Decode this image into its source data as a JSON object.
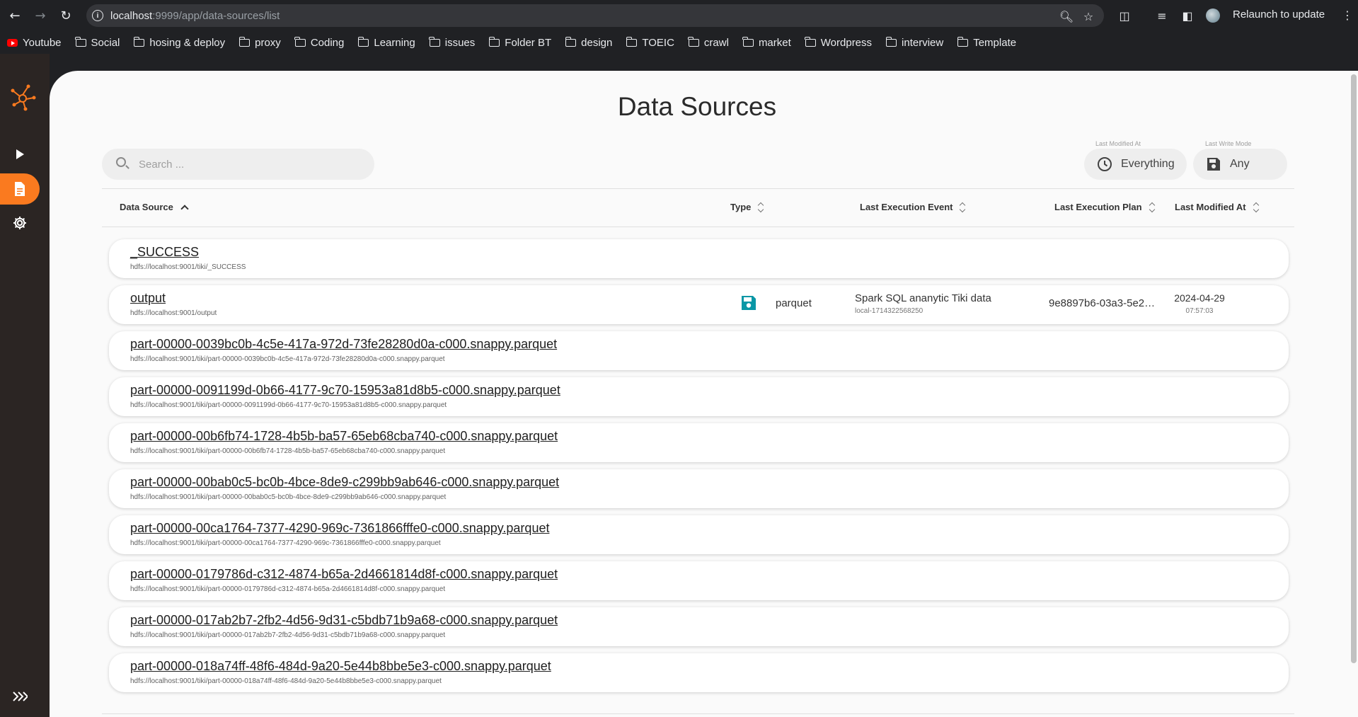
{
  "browser": {
    "url_host": "localhost",
    "url_path": ":9999/app/data-sources/list",
    "relaunch_label": "Relaunch to update",
    "bookmarks": [
      {
        "label": "Youtube",
        "icon": "youtube-icon"
      },
      {
        "label": "Social",
        "icon": "folder-icon"
      },
      {
        "label": "hosing & deploy",
        "icon": "folder-icon"
      },
      {
        "label": "proxy",
        "icon": "folder-icon"
      },
      {
        "label": "Coding",
        "icon": "folder-icon"
      },
      {
        "label": "Learning",
        "icon": "folder-icon"
      },
      {
        "label": "issues",
        "icon": "folder-icon"
      },
      {
        "label": "Folder BT",
        "icon": "folder-icon"
      },
      {
        "label": "design",
        "icon": "folder-icon"
      },
      {
        "label": "TOEIC",
        "icon": "folder-icon"
      },
      {
        "label": "crawl",
        "icon": "folder-icon"
      },
      {
        "label": "market",
        "icon": "folder-icon"
      },
      {
        "label": "Wordpress",
        "icon": "folder-icon"
      },
      {
        "label": "interview",
        "icon": "folder-icon"
      },
      {
        "label": "Template",
        "icon": "folder-icon"
      }
    ]
  },
  "app": {
    "accent_color": "#fa7a1f",
    "sidebar_items": [
      "play-icon",
      "document-icon",
      "settings-gear-icon",
      "expand-chevrons-icon"
    ]
  },
  "page": {
    "title": "Data Sources",
    "search_placeholder": "Search ...",
    "filters": {
      "modified_caption": "Last Modified At",
      "modified_value": "Everything",
      "write_caption": "Last Write Mode",
      "write_value": "Any"
    },
    "columns": {
      "data_source": "Data Source",
      "type": "Type",
      "event": "Last Execution Event",
      "plan": "Last Execution Plan",
      "modified": "Last Modified At"
    },
    "rows": [
      {
        "name": "_SUCCESS",
        "uri": "hdfs://localhost:9001/tiki/_SUCCESS",
        "type": "",
        "event": "",
        "event_sub": "",
        "plan": "",
        "date": "",
        "time": ""
      },
      {
        "name": "output",
        "uri": "hdfs://localhost:9001/output",
        "type": "parquet",
        "event": "Spark SQL ananytic Tiki data",
        "event_sub": "local-1714322568250",
        "plan": "9e8897b6-03a3-5e2…",
        "date": "2024-04-29",
        "time": "07:57:03"
      },
      {
        "name": "part-00000-0039bc0b-4c5e-417a-972d-73fe28280d0a-c000.snappy.parquet",
        "uri": "hdfs://localhost:9001/tiki/part-00000-0039bc0b-4c5e-417a-972d-73fe28280d0a-c000.snappy.parquet",
        "type": "",
        "event": "",
        "event_sub": "",
        "plan": "",
        "date": "",
        "time": ""
      },
      {
        "name": "part-00000-0091199d-0b66-4177-9c70-15953a81d8b5-c000.snappy.parquet",
        "uri": "hdfs://localhost:9001/tiki/part-00000-0091199d-0b66-4177-9c70-15953a81d8b5-c000.snappy.parquet",
        "type": "",
        "event": "",
        "event_sub": "",
        "plan": "",
        "date": "",
        "time": ""
      },
      {
        "name": "part-00000-00b6fb74-1728-4b5b-ba57-65eb68cba740-c000.snappy.parquet",
        "uri": "hdfs://localhost:9001/tiki/part-00000-00b6fb74-1728-4b5b-ba57-65eb68cba740-c000.snappy.parquet",
        "type": "",
        "event": "",
        "event_sub": "",
        "plan": "",
        "date": "",
        "time": ""
      },
      {
        "name": "part-00000-00bab0c5-bc0b-4bce-8de9-c299bb9ab646-c000.snappy.parquet",
        "uri": "hdfs://localhost:9001/tiki/part-00000-00bab0c5-bc0b-4bce-8de9-c299bb9ab646-c000.snappy.parquet",
        "type": "",
        "event": "",
        "event_sub": "",
        "plan": "",
        "date": "",
        "time": ""
      },
      {
        "name": "part-00000-00ca1764-7377-4290-969c-7361866fffe0-c000.snappy.parquet",
        "uri": "hdfs://localhost:9001/tiki/part-00000-00ca1764-7377-4290-969c-7361866fffe0-c000.snappy.parquet",
        "type": "",
        "event": "",
        "event_sub": "",
        "plan": "",
        "date": "",
        "time": ""
      },
      {
        "name": "part-00000-0179786d-c312-4874-b65a-2d4661814d8f-c000.snappy.parquet",
        "uri": "hdfs://localhost:9001/tiki/part-00000-0179786d-c312-4874-b65a-2d4661814d8f-c000.snappy.parquet",
        "type": "",
        "event": "",
        "event_sub": "",
        "plan": "",
        "date": "",
        "time": ""
      },
      {
        "name": "part-00000-017ab2b7-2fb2-4d56-9d31-c5bdb71b9a68-c000.snappy.parquet",
        "uri": "hdfs://localhost:9001/tiki/part-00000-017ab2b7-2fb2-4d56-9d31-c5bdb71b9a68-c000.snappy.parquet",
        "type": "",
        "event": "",
        "event_sub": "",
        "plan": "",
        "date": "",
        "time": ""
      },
      {
        "name": "part-00000-018a74ff-48f6-484d-9a20-5e44b8bbe5e3-c000.snappy.parquet",
        "uri": "hdfs://localhost:9001/tiki/part-00000-018a74ff-48f6-484d-9a20-5e44b8bbe5e3-c000.snappy.parquet",
        "type": "",
        "event": "",
        "event_sub": "",
        "plan": "",
        "date": "",
        "time": ""
      }
    ]
  }
}
